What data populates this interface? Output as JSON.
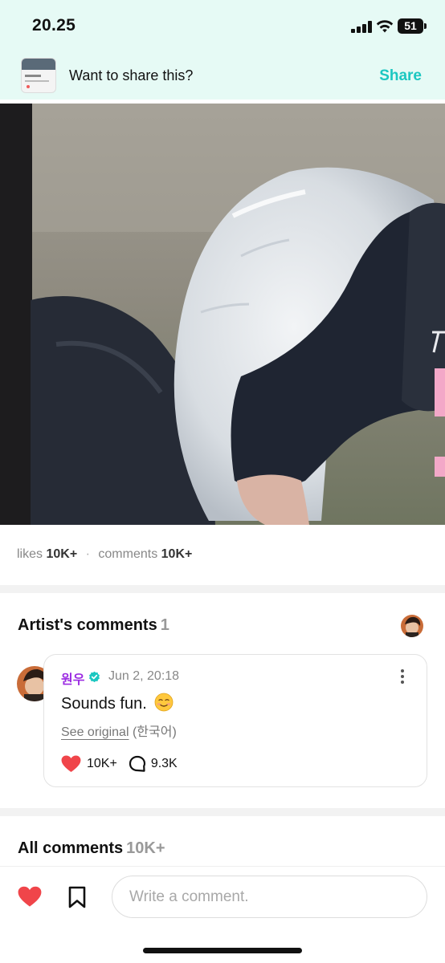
{
  "status_bar": {
    "time": "20.25",
    "battery": "51"
  },
  "share_banner": {
    "prompt": "Want to share this?",
    "action": "Share"
  },
  "post_stats": {
    "likes_label": "likes",
    "likes_value": "10K+",
    "separator": "·",
    "comments_label": "comments",
    "comments_value": "10K+"
  },
  "artist_comments": {
    "title": "Artist's comments",
    "count": "1",
    "comment": {
      "author": "원우",
      "date": "Jun 2, 20:18",
      "body": "Sounds fun.",
      "translate_link": "See original",
      "language": "(한국어)",
      "likes": "10K+",
      "replies": "9.3K"
    }
  },
  "all_comments": {
    "title": "All comments",
    "count": "10K+"
  },
  "composer": {
    "placeholder": "Write a comment."
  },
  "colors": {
    "banner_bg": "#e6faf5",
    "accent": "#1cc7c1",
    "author_name": "#9b2be2",
    "like_red": "#f0454a",
    "verified": "#1cc7c1"
  },
  "icons": {
    "signal": "signal-icon",
    "wifi": "wifi-icon",
    "battery": "battery-icon",
    "verified": "verified-badge-icon",
    "more": "more-vertical-icon",
    "emoji": "smiling-face-icon",
    "heart": "heart-icon",
    "comment": "comment-bubble-icon",
    "bookmark": "bookmark-icon"
  }
}
